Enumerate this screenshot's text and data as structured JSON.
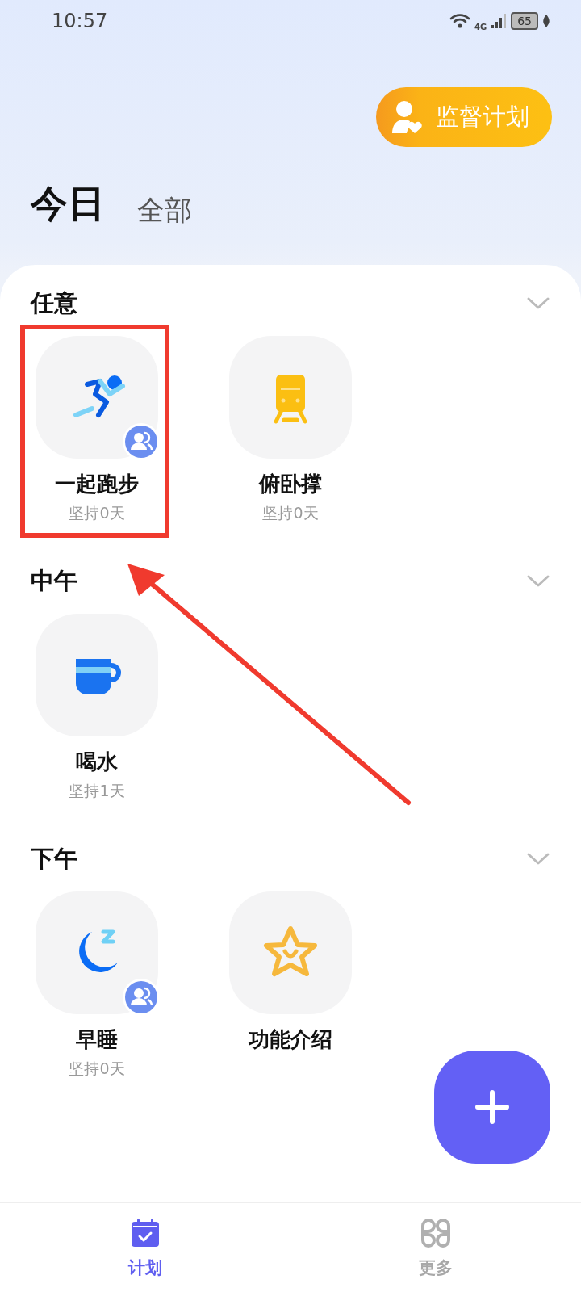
{
  "status_bar": {
    "time": "10:57",
    "network": "4G",
    "battery": "65"
  },
  "supervise_button": {
    "label": "监督计划"
  },
  "tabs": [
    {
      "label": "今日",
      "selected": true
    },
    {
      "label": "全部",
      "selected": false
    }
  ],
  "sections": [
    {
      "title": "任意",
      "expanded": true,
      "items": [
        {
          "name": "一起跑步",
          "streak": "坚持0天",
          "kind": "runner",
          "shared": true,
          "highlighted": true
        },
        {
          "name": "俯卧撑",
          "streak": "坚持0天",
          "kind": "train",
          "shared": false,
          "highlighted": false
        }
      ]
    },
    {
      "title": "中午",
      "expanded": true,
      "items": [
        {
          "name": "喝水",
          "streak": "坚持1天",
          "kind": "cup",
          "shared": false,
          "highlighted": false
        }
      ]
    },
    {
      "title": "下午",
      "expanded": true,
      "items": [
        {
          "name": "早睡",
          "streak": "坚持0天",
          "kind": "moon",
          "shared": true,
          "highlighted": false
        },
        {
          "name": "功能介绍",
          "kind": "star",
          "shared": false,
          "highlighted": false
        }
      ]
    }
  ],
  "annotation_arrow": true,
  "bottom_nav": [
    {
      "label": "计划",
      "kind": "calendar",
      "selected": true
    },
    {
      "label": "更多",
      "kind": "grid",
      "selected": false
    }
  ]
}
